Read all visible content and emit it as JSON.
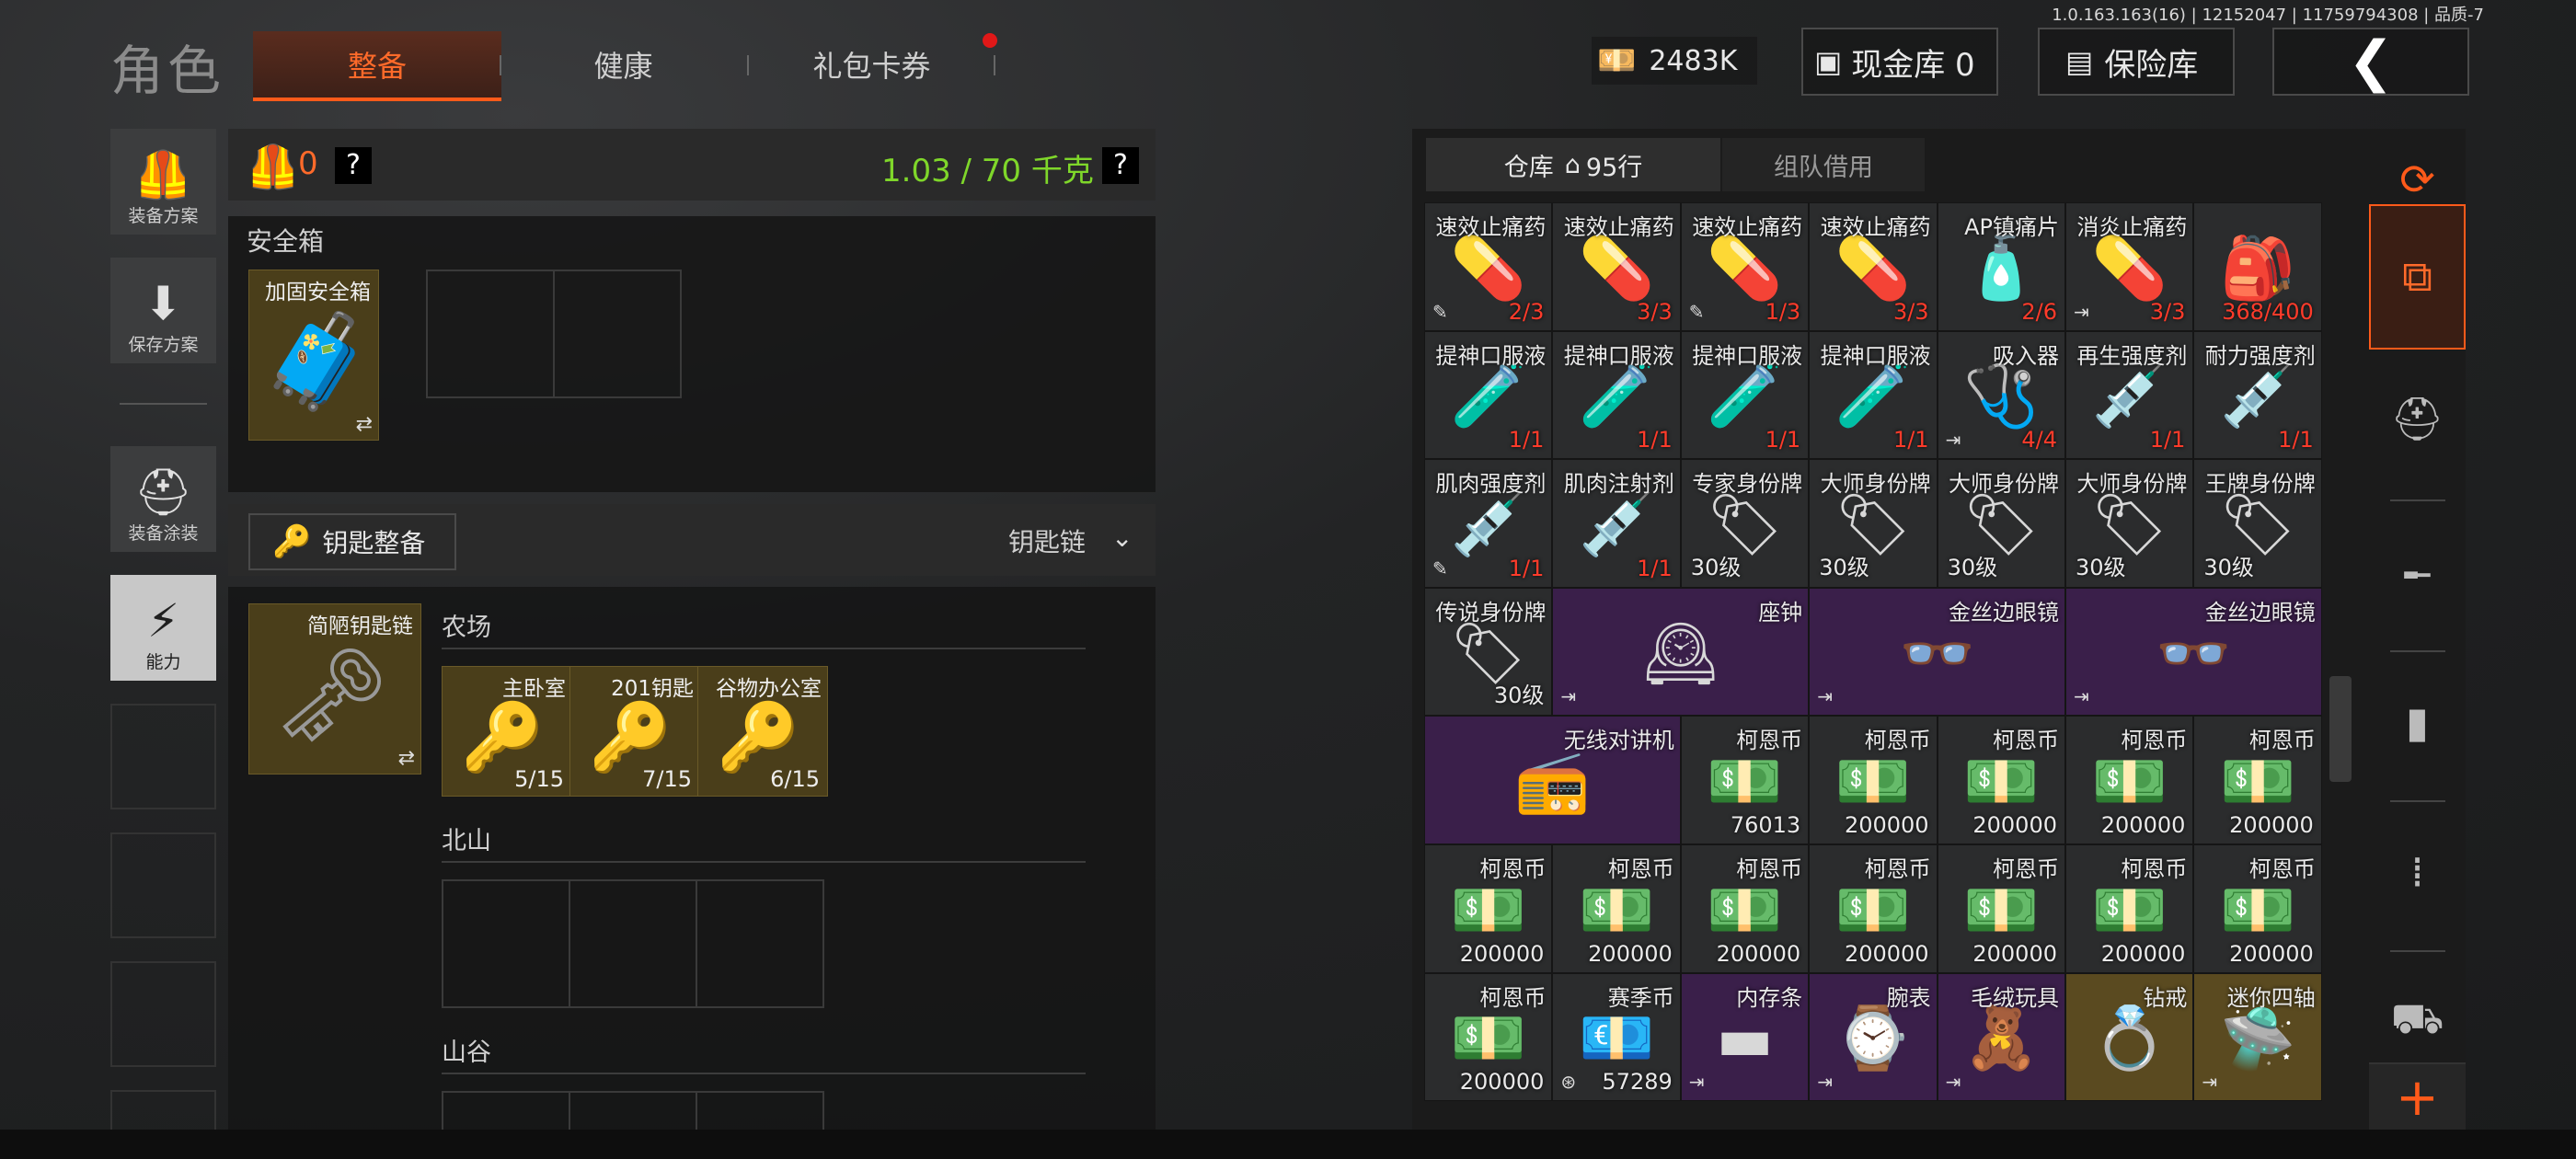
{
  "version": "1.0.163.163(16) | 12152047 | 11759794308 | 品质-7",
  "header": {
    "title": "角色",
    "tabs": [
      {
        "label": "整备",
        "active": true
      },
      {
        "label": "健康",
        "active": false
      },
      {
        "label": "礼包卡券",
        "active": false,
        "notification": true
      }
    ],
    "cash": "2483K",
    "cash_vault": "现金库 0",
    "safe": "保险库"
  },
  "left_tools": [
    {
      "label": "装备方案",
      "icon": "vest-icon"
    },
    {
      "label": "保存方案",
      "icon": "download-icon"
    },
    {
      "label": "装备涂装",
      "icon": "helmet-icon"
    },
    {
      "label": "能力",
      "icon": "lightning-icon",
      "active": true
    }
  ],
  "loadout": {
    "armor_count": "0",
    "weight": "1.03 / 70 千克",
    "help": "?",
    "safe_box_title": "安全箱",
    "safe_box_item": "加固安全箱",
    "key_section_button": "钥匙整备",
    "keychain_dropdown": "钥匙链",
    "keychain_item": "简陋钥匙链",
    "areas": [
      {
        "name": "农场",
        "keys": [
          {
            "name": "主卧室",
            "count": "5/15"
          },
          {
            "name": "201钥匙",
            "count": "7/15"
          },
          {
            "name": "谷物办公室",
            "count": "6/15"
          }
        ]
      },
      {
        "name": "北山",
        "keys": []
      },
      {
        "name": "山谷",
        "keys": []
      }
    ]
  },
  "warehouse": {
    "tab_storage": "仓库",
    "rows": "95行",
    "tab_team": "组队借用",
    "items": [
      {
        "name": "速效止痛药",
        "count": "2/3",
        "red": true,
        "icon": "💊",
        "flag": "✎",
        "bg": "#2b2c2d"
      },
      {
        "name": "速效止痛药",
        "count": "3/3",
        "red": true,
        "icon": "💊",
        "bg": "#2b2c2d"
      },
      {
        "name": "速效止痛药",
        "count": "1/3",
        "red": true,
        "icon": "💊",
        "flag": "✎",
        "bg": "#2b2c2d"
      },
      {
        "name": "速效止痛药",
        "count": "3/3",
        "red": true,
        "icon": "💊",
        "bg": "#2b2c2d"
      },
      {
        "name": "AP镇痛片",
        "count": "2/6",
        "red": true,
        "icon": "🧴",
        "bg": "#2b2c2d"
      },
      {
        "name": "消炎止痛药",
        "count": "3/3",
        "red": true,
        "icon": "💊",
        "flag": "⇥",
        "bg": "#2b2c2d"
      },
      {
        "name": "",
        "count": "368/400",
        "red": true,
        "icon": "🎒",
        "bg": "#2b2c2d"
      },
      {
        "name": "提神口服液",
        "count": "1/1",
        "red": true,
        "icon": "🧪",
        "bg": "#2b2c2d"
      },
      {
        "name": "提神口服液",
        "count": "1/1",
        "red": true,
        "icon": "🧪",
        "bg": "#2b2c2d"
      },
      {
        "name": "提神口服液",
        "count": "1/1",
        "red": true,
        "icon": "🧪",
        "bg": "#2b2c2d"
      },
      {
        "name": "提神口服液",
        "count": "1/1",
        "red": true,
        "icon": "🧪",
        "bg": "#2b2c2d"
      },
      {
        "name": "吸入器",
        "count": "4/4",
        "red": true,
        "icon": "🩺",
        "flag": "⇥",
        "bg": "#2b2c2d"
      },
      {
        "name": "再生强度剂",
        "count": "1/1",
        "red": true,
        "icon": "💉",
        "bg": "#2b2c2d"
      },
      {
        "name": "耐力强度剂",
        "count": "1/1",
        "red": true,
        "icon": "💉",
        "bg": "#2b2c2d"
      },
      {
        "name": "肌肉强度剂",
        "count": "1/1",
        "red": true,
        "icon": "💉",
        "flag": "✎",
        "bg": "#2b2c2d"
      },
      {
        "name": "肌肉注射剂",
        "count": "1/1",
        "red": true,
        "icon": "💉",
        "bg": "#2b2c2d"
      },
      {
        "name": "专家身份牌",
        "count": "30级",
        "left": true,
        "icon": "🏷",
        "bg": "#2b2c2d"
      },
      {
        "name": "大师身份牌",
        "count": "30级",
        "left": true,
        "icon": "🏷",
        "bg": "#2b2c2d"
      },
      {
        "name": "大师身份牌",
        "count": "30级",
        "left": true,
        "icon": "🏷",
        "bg": "#2b2c2d"
      },
      {
        "name": "大师身份牌",
        "count": "30级",
        "left": true,
        "icon": "🏷",
        "bg": "#2b2c2d"
      },
      {
        "name": "王牌身份牌",
        "count": "30级",
        "left": true,
        "icon": "🏷",
        "bg": "#2b2c2d"
      }
    ],
    "row4": [
      {
        "name": "传说身份牌",
        "count": "30级",
        "span": 1,
        "icon": "🏷",
        "bg": "#2b2c2d"
      },
      {
        "name": "座钟",
        "count": "",
        "span": 2,
        "icon": "🕰",
        "flag": "⇥",
        "bg": "#3a1f4a"
      },
      {
        "name": "金丝边眼镜",
        "count": "",
        "span": 2,
        "icon": "👓",
        "flag": "⇥",
        "bg": "#3a1f4a"
      },
      {
        "name": "金丝边眼镜",
        "count": "",
        "span": 2,
        "icon": "👓",
        "flag": "⇥",
        "bg": "#3a1f4a"
      }
    ],
    "row5": [
      {
        "name": "无线对讲机",
        "count": "",
        "span": 2,
        "icon": "📻",
        "bg": "#3a1f4a"
      },
      {
        "name": "柯恩币",
        "count": "76013",
        "span": 1,
        "icon": "💵",
        "bg": "#2b2c2d"
      },
      {
        "name": "柯恩币",
        "count": "200000",
        "span": 1,
        "icon": "💵",
        "bg": "#2b2c2d"
      },
      {
        "name": "柯恩币",
        "count": "200000",
        "span": 1,
        "icon": "💵",
        "bg": "#2b2c2d"
      },
      {
        "name": "柯恩币",
        "count": "200000",
        "span": 1,
        "icon": "💵",
        "bg": "#2b2c2d"
      },
      {
        "name": "柯恩币",
        "count": "200000",
        "span": 1,
        "icon": "💵",
        "bg": "#2b2c2d"
      }
    ],
    "row6": [
      {
        "name": "柯恩币",
        "count": "200000",
        "icon": "💵"
      },
      {
        "name": "柯恩币",
        "count": "200000",
        "icon": "💵"
      },
      {
        "name": "柯恩币",
        "count": "200000",
        "icon": "💵"
      },
      {
        "name": "柯恩币",
        "count": "200000",
        "icon": "💵"
      },
      {
        "name": "柯恩币",
        "count": "200000",
        "icon": "💵"
      },
      {
        "name": "柯恩币",
        "count": "200000",
        "icon": "💵"
      },
      {
        "name": "柯恩币",
        "count": "200000",
        "icon": "💵"
      }
    ],
    "row7": [
      {
        "name": "柯恩币",
        "count": "200000",
        "icon": "💵",
        "bg": "#2b2c2d"
      },
      {
        "name": "赛季币",
        "count": "57289",
        "icon": "💶",
        "bg": "#2b2c2d",
        "flag": "⊛"
      },
      {
        "name": "内存条",
        "count": "",
        "icon": "▬",
        "bg": "#3a1f4a",
        "flag": "⇥"
      },
      {
        "name": "腕表",
        "count": "",
        "icon": "⌚",
        "bg": "#3a1f4a",
        "flag": "⇥"
      },
      {
        "name": "毛绒玩具",
        "count": "",
        "icon": "🧸",
        "bg": "#3a1f4a",
        "flag": "⇥"
      },
      {
        "name": "钻戒",
        "count": "",
        "icon": "💍",
        "bg": "#5a4a20"
      },
      {
        "name": "迷你四轴",
        "count": "",
        "icon": "🛸",
        "bg": "#5a4a20",
        "flag": "⇥"
      }
    ]
  },
  "side_icons": [
    "stack-sync-icon",
    "stack-transfer-icon",
    "helmet-icon",
    "rifle-icon",
    "magazine-icon",
    "ammo-icon",
    "tank-icon",
    "plus-icon"
  ]
}
